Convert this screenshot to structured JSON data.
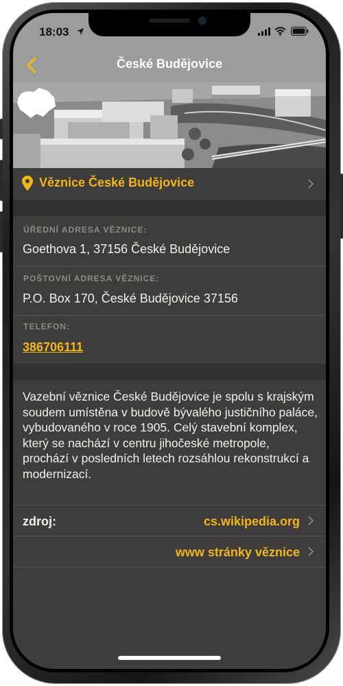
{
  "status": {
    "time": "18:03"
  },
  "nav": {
    "title": "České Budějovice"
  },
  "prison": {
    "name": "Věznice České Budějovice"
  },
  "info": {
    "official_address_label": "ÚŘEDNÍ ADRESA VĚZNICE:",
    "official_address": "Goethova 1, 37156 České Budějovice",
    "postal_address_label": "POŠTOVNÍ ADRESA VĚZNICE:",
    "postal_address": "P.O. Box 170, České Budějovice 37156",
    "phone_label": "TELEFON:",
    "phone": "386706111"
  },
  "description": "Vazební věznice České Budějovice je spolu s krajským soudem umístěna v budově bývalého justičního paláce, vybudovaného v roce 1905. Celý stavební komplex, který se nachází v centru jihočeské metropole, prochází v posledních letech rozsáhlou rekonstrukcí a modernizací.",
  "source": {
    "label": "zdroj:",
    "link": "cs.wikipedia.org"
  },
  "website": {
    "link": "www stránky věznice"
  },
  "colors": {
    "accent": "#f2b51a",
    "nav_bg": "#9c9c9c",
    "content_bg": "#3f3d3b"
  }
}
